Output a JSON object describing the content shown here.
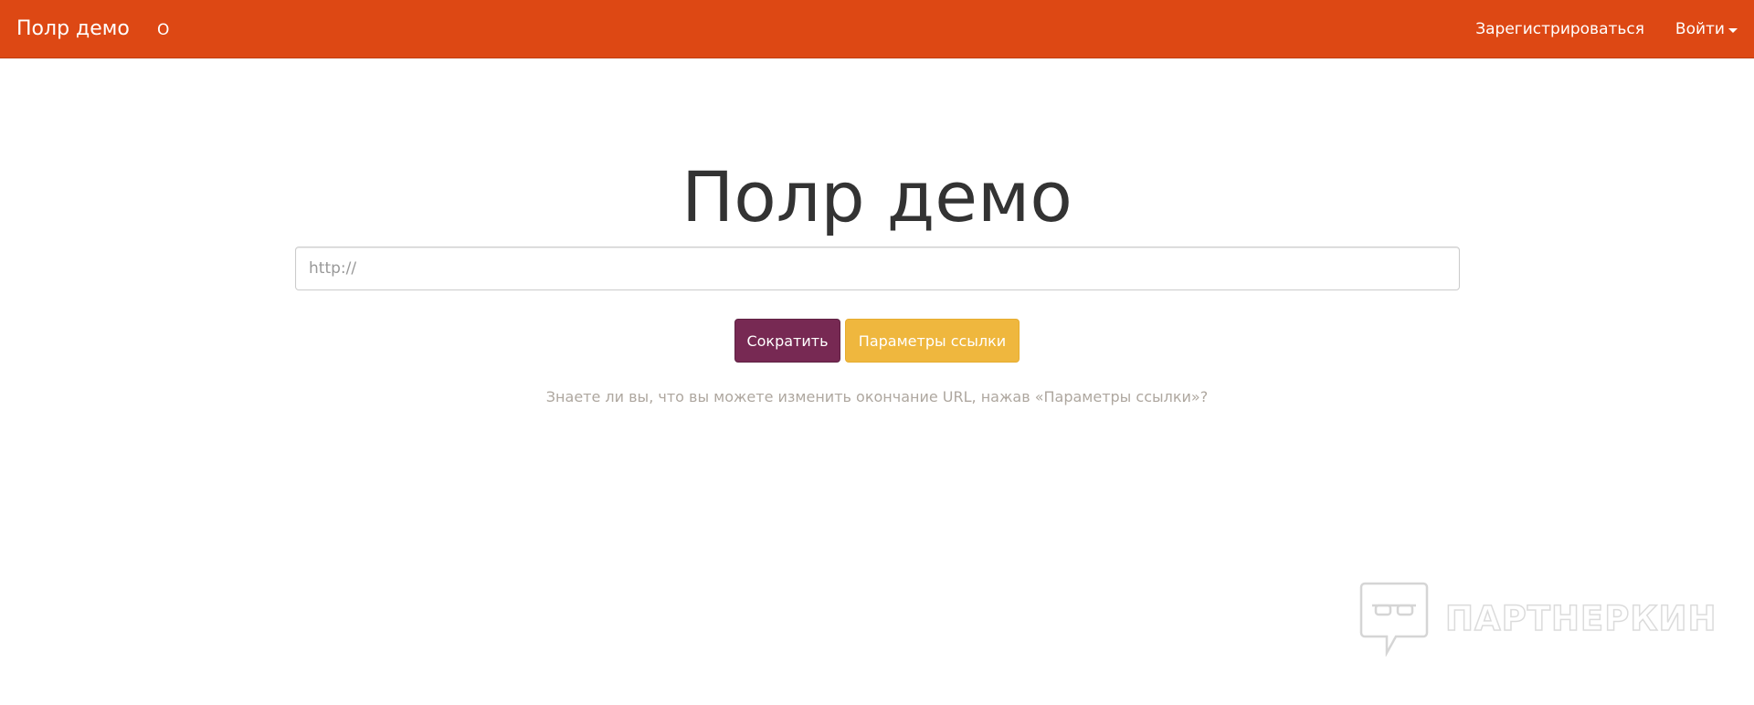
{
  "navbar": {
    "brand": "Полр демо",
    "about": "О",
    "register": "Зарегистрироваться",
    "login": "Войти",
    "background_color": "#dd4814"
  },
  "hero": {
    "title": "Полр демо"
  },
  "url_input": {
    "value": "",
    "placeholder": "http://"
  },
  "buttons": {
    "shorten": "Сократить",
    "shorten_color": "#772953",
    "params": "Параметры ссылки",
    "params_color": "#efb73e"
  },
  "tip": "Знаете ли вы, что вы можете изменить окончание URL, нажав «Параметры ссылки»?",
  "watermark": {
    "icon": "speech-bubble-glasses-icon",
    "text": "ПАРТНЕРКИН"
  }
}
